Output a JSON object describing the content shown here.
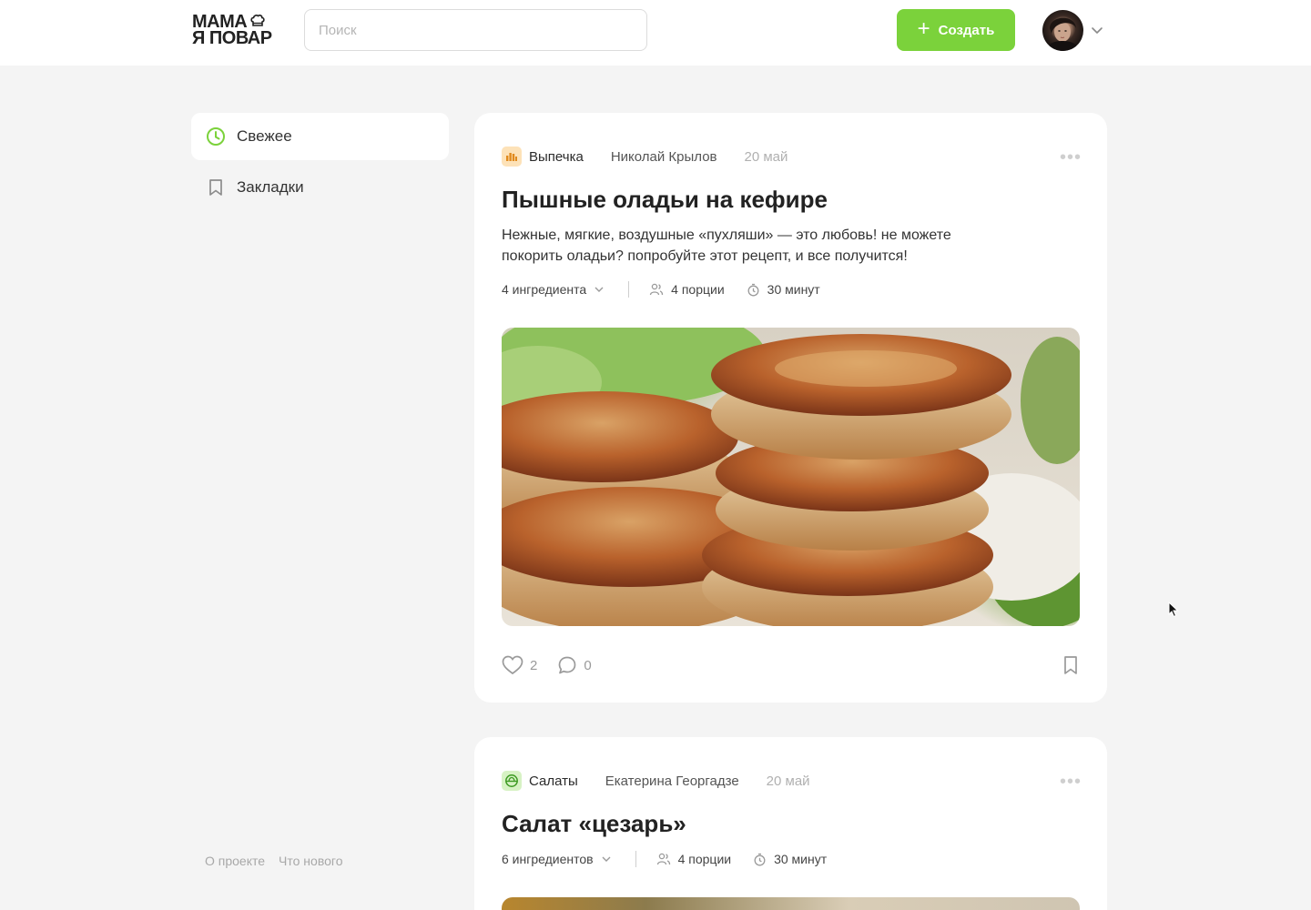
{
  "header": {
    "logo_line1": "МАМА",
    "logo_line2": "Я ПОВАР",
    "search_placeholder": "Поиск",
    "create_label": "Создать",
    "accent": "#7bd23b"
  },
  "sidebar": {
    "items": [
      {
        "label": "Свежее",
        "icon": "clock-icon",
        "active": true
      },
      {
        "label": "Закладки",
        "icon": "bookmark-icon",
        "active": false
      }
    ],
    "footer": [
      "О проекте",
      "Что нового"
    ]
  },
  "posts": [
    {
      "category": "Выпечка",
      "category_icon": "bread-icon",
      "author": "Николай Крылов",
      "date": "20 май",
      "title": "Пышные оладьи на кефире",
      "description": "Нежные, мягкие, воздушные «пухляши» — это любовь! не можете покорить оладьи? попробуйте этот рецепт, и все получится!",
      "ingredients": "4 ингредиента",
      "portions": "4 порции",
      "time": "30 минут",
      "likes": "2",
      "comments": "0"
    },
    {
      "category": "Салаты",
      "category_icon": "salad-icon",
      "author": "Екатерина Георгадзе",
      "date": "20 май",
      "title": "Салат «цезарь»",
      "ingredients": "6 ингредиентов",
      "portions": "4 порции",
      "time": "30 минут"
    }
  ]
}
